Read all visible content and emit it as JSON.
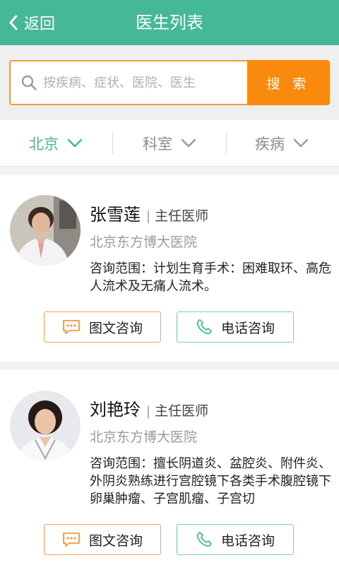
{
  "header": {
    "back_label": "返回",
    "title": "医生列表",
    "color": "#45b995"
  },
  "search": {
    "placeholder": "按疾病、症状、医院、医生",
    "button_label": "搜 索",
    "button_color": "#f98a0d"
  },
  "filters": [
    {
      "label": "北京",
      "active": true
    },
    {
      "label": "科室",
      "active": false
    },
    {
      "label": "疾病",
      "active": false
    }
  ],
  "doctors": [
    {
      "name": "张雪莲",
      "separator": "|",
      "title": "主任医师",
      "hospital": "北京东方博大医院",
      "scope": "咨询范围：计划生育手术：困难取环、高危人流术及无痛人流术。",
      "avatar_icon": "doctor-photo-icon",
      "text_consult_label": "图文咨询",
      "phone_consult_label": "电话咨询"
    },
    {
      "name": "刘艳玲",
      "separator": "|",
      "title": "主任医师",
      "hospital": "北京东方博大医院",
      "scope": "咨询范围：擅长阴道炎、盆腔炎、附件炎、外阴炎熟练进行宫腔镜下各类手术腹腔镜下卵巢肿瘤、子宫肌瘤、子宫切",
      "avatar_icon": "doctor-photo-icon",
      "text_consult_label": "图文咨询",
      "phone_consult_label": "电话咨询"
    }
  ]
}
